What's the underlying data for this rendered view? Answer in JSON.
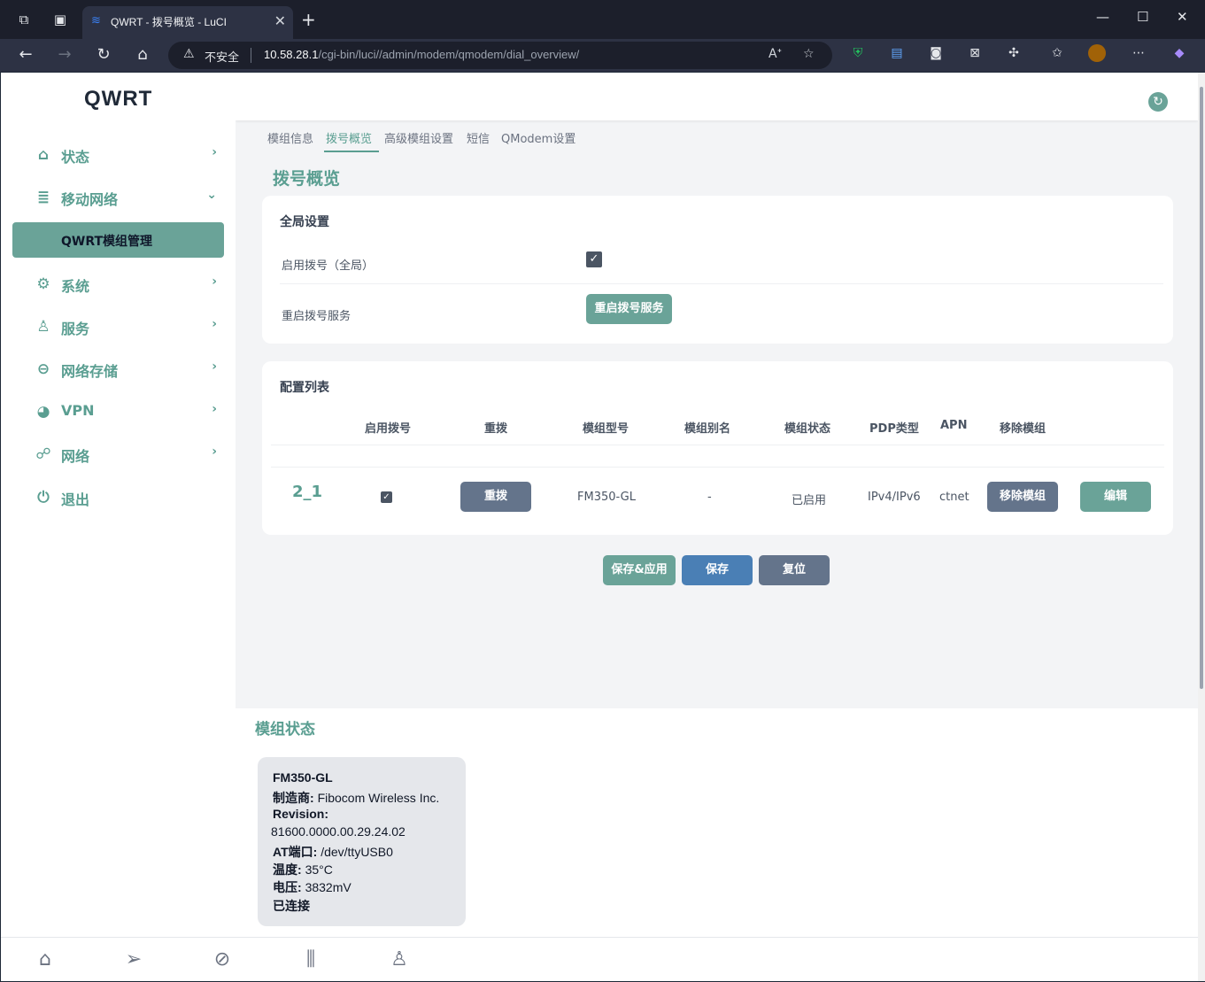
{
  "browser": {
    "tab_title": "QWRT - 拨号概览 - LuCI",
    "insecure_label": "不安全",
    "url_host": "10.58.28.1",
    "url_path": "/cgi-bin/luci//admin/modem/qmodem/dial_overview/"
  },
  "sidebar": {
    "logo": "QWRT",
    "items": [
      {
        "label": "状态",
        "icon": "home-icon"
      },
      {
        "label": "移动网络",
        "icon": "database-icon"
      },
      {
        "label": "系统",
        "icon": "gear-icon"
      },
      {
        "label": "服务",
        "icon": "user-icon"
      },
      {
        "label": "网络存储",
        "icon": "storage-icon"
      },
      {
        "label": "VPN",
        "icon": "globe-icon"
      },
      {
        "label": "网络",
        "icon": "network-icon"
      },
      {
        "label": "退出",
        "icon": "power-icon"
      }
    ],
    "active_sub": "QWRT模组管理"
  },
  "subtabs": [
    "模组信息",
    "拨号概览",
    "高级模组设置",
    "短信",
    "QModem设置"
  ],
  "page_title": "拨号概览",
  "global": {
    "title": "全局设置",
    "enable_label": "启用拨号（全局）",
    "restart_label": "重启拨号服务",
    "restart_button": "重启拨号服务"
  },
  "config": {
    "title": "配置列表",
    "headers": [
      "启用拨号",
      "重拨",
      "模组型号",
      "模组别名",
      "模组状态",
      "PDP类型",
      "APN",
      "移除模组"
    ],
    "row": {
      "id": "2_1",
      "redial_button": "重拨",
      "model": "FM350-GL",
      "alias": "-",
      "status": "已启用",
      "pdp": "IPv4/IPv6",
      "apn": "ctnet",
      "remove_button": "移除模组",
      "edit_button": "编辑"
    }
  },
  "actions": {
    "save_apply": "保存&应用",
    "save": "保存",
    "reset": "复位"
  },
  "modem_status": {
    "title": "模组状态",
    "model": "FM350-GL",
    "manufacturer_label": "制造商:",
    "manufacturer": "Fibocom Wireless Inc.",
    "revision_label": "Revision:",
    "revision": "81600.0000.00.29.24.02",
    "at_port_label": "AT端口:",
    "at_port": "/dev/ttyUSB0",
    "temp_label": "温度:",
    "temp": "35°C",
    "voltage_label": "电压:",
    "voltage": "3832mV",
    "connected": "已连接"
  },
  "colors": {
    "accent": "#5a9e91",
    "button_teal": "#6aa398",
    "button_slate": "#64748b",
    "button_blue": "#4a7fb5"
  }
}
